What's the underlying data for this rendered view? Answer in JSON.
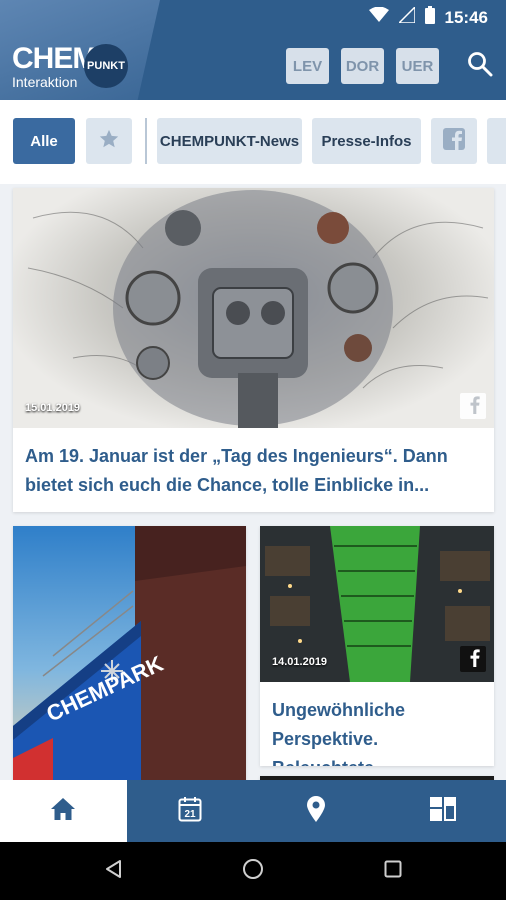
{
  "status": {
    "time": "15:46"
  },
  "header": {
    "logo_main": "CHEM",
    "logo_circle": "PUNKT",
    "logo_sub": "Interaktion",
    "sites": [
      "LEV",
      "DOR",
      "UER"
    ]
  },
  "filters": {
    "all_label": "Alle",
    "news_label": "CHEMPUNKT-News",
    "press_label": "Presse-Infos"
  },
  "feed": {
    "featured": {
      "date": "15.01.2019",
      "text": "Am 19. Januar ist der „Tag des Ingenieurs“. Dann bietet sich euch die Chance, tolle Einblicke in..."
    },
    "second": {
      "date": "14.01.2019",
      "text": "Ungewöhnliche Perspektive. Beleuchtete..."
    },
    "left_image_sign": "CHEMPARK"
  },
  "colors": {
    "brand": "#2f5d8c",
    "chip": "#dce5ee",
    "chip_active": "#3a6aa0"
  },
  "icons": {
    "bottom_nav": [
      "home-icon",
      "calendar-icon",
      "location-icon",
      "dashboard-icon"
    ],
    "calendar_day": "21"
  }
}
